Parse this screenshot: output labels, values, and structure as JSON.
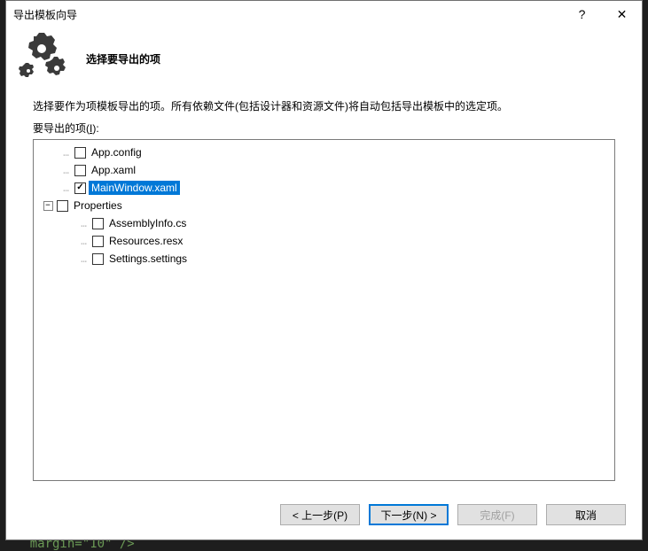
{
  "window": {
    "title": "导出模板向导",
    "help_symbol": "?",
    "close_symbol": "✕"
  },
  "header": {
    "heading": "选择要导出的项"
  },
  "content": {
    "description": "选择要作为项模板导出的项。所有依赖文件(包括设计器和资源文件)将自动包括导出模板中的选定项。",
    "items_label_prefix": "要导出的项(",
    "items_label_key": "I",
    "items_label_suffix": "):"
  },
  "tree": {
    "items": [
      {
        "label": "App.config",
        "checked": false,
        "selected": false,
        "indent": 1
      },
      {
        "label": "App.xaml",
        "checked": false,
        "selected": false,
        "indent": 1
      },
      {
        "label": "MainWindow.xaml",
        "checked": true,
        "selected": true,
        "indent": 1
      },
      {
        "label": "Properties",
        "checked": false,
        "selected": false,
        "indent": 0,
        "expandable": true,
        "expanded": true
      },
      {
        "label": "AssemblyInfo.cs",
        "checked": false,
        "selected": false,
        "indent": 2
      },
      {
        "label": "Resources.resx",
        "checked": false,
        "selected": false,
        "indent": 2
      },
      {
        "label": "Settings.settings",
        "checked": false,
        "selected": false,
        "indent": 2
      }
    ]
  },
  "footer": {
    "prev": "< 上一步(P)",
    "next": "下一步(N) >",
    "finish": "完成(F)",
    "cancel": "取消"
  },
  "background_code": "    margin=\"10\" />"
}
